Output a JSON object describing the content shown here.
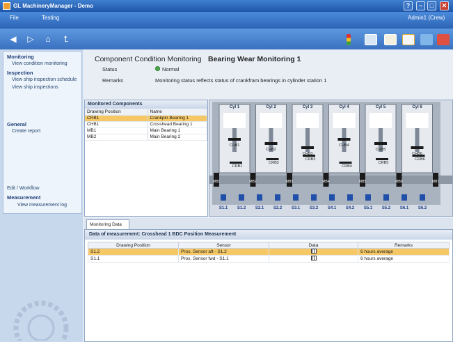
{
  "window": {
    "title": "GL MachineryManager - Demo"
  },
  "menu": {
    "file": "File",
    "testing": "Testing",
    "user": "Admin1 (Crew)"
  },
  "sidebar": {
    "monitoring_header": "Monitoring",
    "view_condition": "View condition monitoring",
    "inspection_header": "Inspection",
    "view_schedule": "View ship inspection schedule",
    "view_inspections": "View ship inspections",
    "general_header": "General",
    "create_report": "Create report",
    "edit_workflow": "Edit / Workflow",
    "measurement_header": "Measurement",
    "view_log": "View measurement log"
  },
  "header": {
    "section": "Component Condition Monitoring",
    "name": "Bearing Wear Monitoring 1",
    "status_label": "Status",
    "status_value": "Normal",
    "remarks_label": "Remarks",
    "remarks_value": "Monitoring status reflects status of crankfram bearings in cylinder station 1"
  },
  "monitored": {
    "title": "Monitored Components",
    "col_position": "Drawing Position",
    "col_name": "Name",
    "rows": [
      {
        "pos": "CRB1",
        "name": "Crankpin Bearing 1"
      },
      {
        "pos": "CHB1",
        "name": "Crosshead Bearing 1"
      },
      {
        "pos": "MB1",
        "name": "Main Bearing 1"
      },
      {
        "pos": "MB2",
        "name": "Main Bearing 2"
      }
    ]
  },
  "diagram": {
    "cylinders": [
      "Cyl 1",
      "Cyl 2",
      "Cyl 3",
      "Cyl 4",
      "Cyl 5",
      "Cyl 6"
    ],
    "chb": [
      "CHB1",
      "CHB2",
      "CHB3",
      "CHB4",
      "CHB5",
      "CHB6"
    ],
    "crb": [
      "CRB1",
      "CRB2",
      "CRB3",
      "CRB4",
      "CRB5",
      "CRB6"
    ],
    "mb": [
      "MB1",
      "MB2",
      "MB3",
      "MB4",
      "MB5",
      "MB6",
      "MB7"
    ],
    "sensors": [
      "S1.1",
      "S1.2",
      "S2.1",
      "S2.2",
      "S3.1",
      "S3.2",
      "S4.1",
      "S4.2",
      "S5.1",
      "S5.2",
      "S6.1",
      "S6.2"
    ]
  },
  "tabs": {
    "monitoring_data": "Monitoring Data"
  },
  "measurement": {
    "title": "Data of measurement: Crosshead 1 BDC Position Measurement",
    "col_position": "Drawing Position",
    "col_sensor": "Sensor",
    "col_data": "Data",
    "col_remarks": "Remarks",
    "rows": [
      {
        "pos": "S1.2",
        "sensor": "Prox. Sensor aft - S1.2",
        "remarks": "6 hours average"
      },
      {
        "pos": "S1.1",
        "sensor": "Prox. Sensor fwd - S1.1",
        "remarks": "6 hours average"
      }
    ]
  },
  "colors": {
    "title_bar": "#2a62b3",
    "selection": "#f5c765",
    "status_ok": "#4caa4c",
    "sensor": "#1f4fa8"
  }
}
